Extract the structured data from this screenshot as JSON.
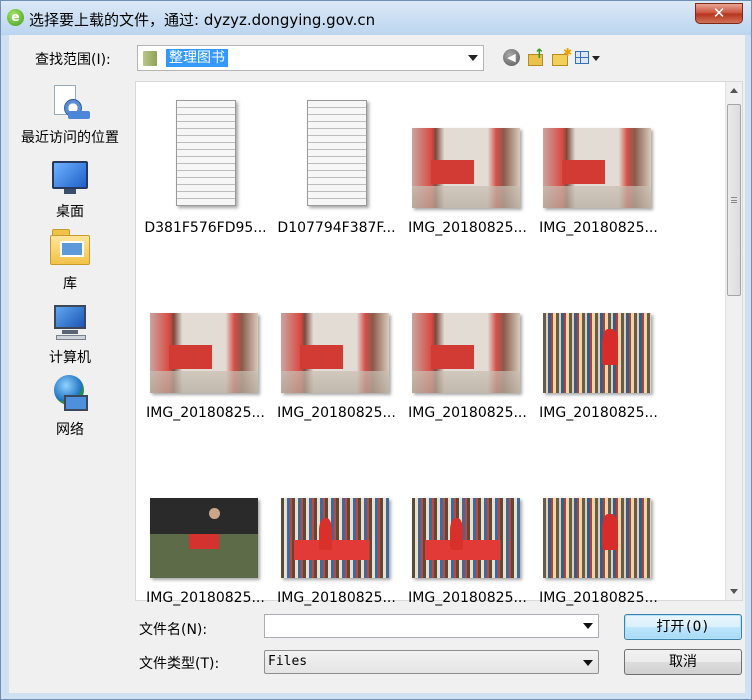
{
  "window": {
    "title": "选择要上载的文件，通过: dyzyz.dongying.gov.cn",
    "close_label": "✕"
  },
  "toolbar": {
    "look_in_label": "查找范围(I):",
    "look_in_value": "整理图书",
    "back_glyph": "◀",
    "up_glyph": "↑",
    "new_folder_glyph": "✱"
  },
  "places": [
    {
      "label": "最近访问的位置",
      "icon": "recent-places-icon"
    },
    {
      "label": "桌面",
      "icon": "desktop-icon"
    },
    {
      "label": "库",
      "icon": "libraries-icon"
    },
    {
      "label": "计算机",
      "icon": "computer-icon"
    },
    {
      "label": "网络",
      "icon": "network-icon"
    }
  ],
  "files": [
    {
      "name": "D381F576FD95...",
      "thumb": "doc"
    },
    {
      "name": "D107794F387F...",
      "thumb": "doc"
    },
    {
      "name": "IMG_20180825...",
      "thumb": "group"
    },
    {
      "name": "IMG_20180825...",
      "thumb": "group"
    },
    {
      "name": "IMG_20180825...",
      "thumb": "group"
    },
    {
      "name": "IMG_20180825...",
      "thumb": "group"
    },
    {
      "name": "IMG_20180825...",
      "thumb": "group"
    },
    {
      "name": "IMG_20180825...",
      "thumb": "shelf"
    },
    {
      "name": "IMG_20180825...",
      "thumb": "work"
    },
    {
      "name": "IMG_20180825...",
      "thumb": "shelf2"
    },
    {
      "name": "IMG_20180825...",
      "thumb": "shelf2"
    },
    {
      "name": "IMG_20180825...",
      "thumb": "shelf"
    }
  ],
  "form": {
    "filename_label": "文件名(N):",
    "filename_value": "",
    "filetype_label": "文件类型(T):",
    "filetype_value": "Files"
  },
  "buttons": {
    "open": "打开(O)",
    "cancel": "取消"
  }
}
